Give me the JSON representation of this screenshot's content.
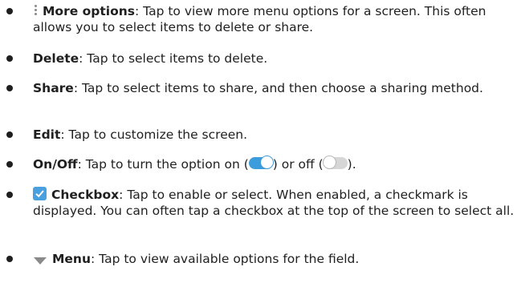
{
  "items": [
    {
      "term": "More options",
      "text": ": Tap to view more menu options for a screen. This often allows you to select items to delete or share.",
      "icon": "kebab-menu-icon"
    },
    {
      "term": "Delete",
      "text": ": Tap to select items to delete."
    },
    {
      "term": "Share",
      "text": ": Tap to select items to share, and then choose a sharing method."
    },
    {
      "term": "Edit",
      "text": ": Tap to customize the screen."
    },
    {
      "term": "On/Off",
      "text_before": ": Tap to turn the option on (",
      "text_middle": ") or off (",
      "text_after": ").",
      "icons": [
        "toggle-on-icon",
        "toggle-off-icon"
      ]
    },
    {
      "term": "Checkbox",
      "text": ": Tap to enable or select. When enabled, a checkmark is displayed. You can often tap a checkbox at the top of the screen to select all.",
      "icon": "checkbox-checked-icon"
    },
    {
      "term": "Menu",
      "text": ": Tap to view available options for the field.",
      "icon": "dropdown-triangle-icon"
    }
  ],
  "colors": {
    "text": "#1f1f1f",
    "accent": "#3d9cdb",
    "icon_gray": "#8a8a8a"
  }
}
